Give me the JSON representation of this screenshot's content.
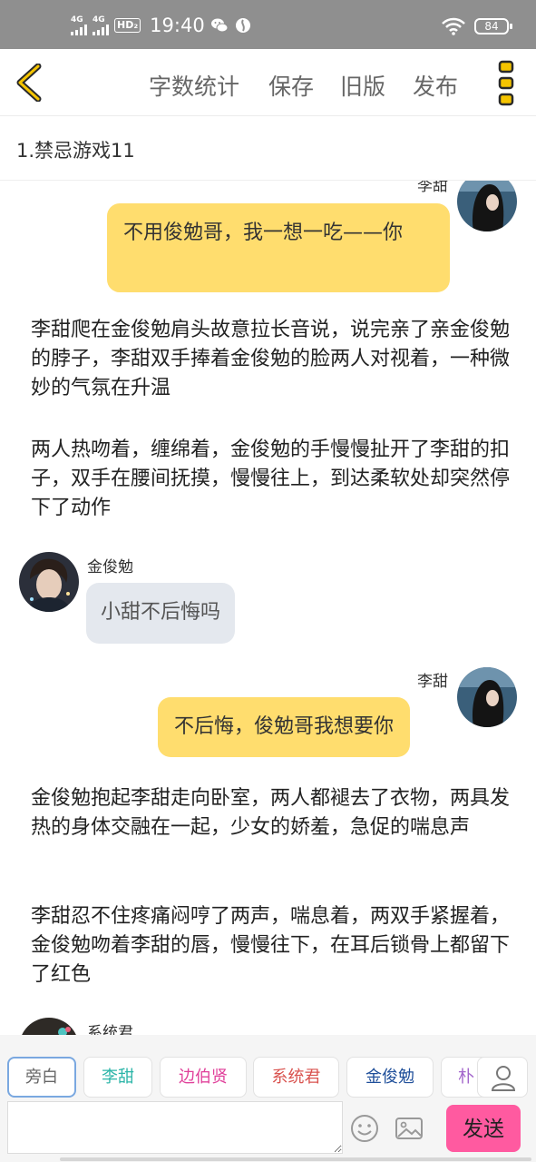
{
  "status_bar": {
    "net1": "4G",
    "net2": "4G",
    "hd": "HD₂",
    "time": "19:40",
    "battery": "84"
  },
  "toolbar": {
    "word_count": "字数统计",
    "save": "保存",
    "old_version": "旧版",
    "publish": "发布"
  },
  "document": {
    "title": "1.禁忌游戏11"
  },
  "messages": [
    {
      "speaker": "李甜",
      "text": "不用俊勉哥，我一想一吃——你"
    },
    {
      "narration": "李甜爬在金俊勉肩头故意拉长音说，说完亲了亲金俊勉的脖子，李甜双手捧着金俊勉的脸两人对视着，一种微妙的气氛在升温"
    },
    {
      "narration": "两人热吻着，缠绵着，金俊勉的手慢慢扯开了李甜的扣子，双手在腰间抚摸，慢慢往上，到达柔软处却突然停下了动作"
    },
    {
      "speaker": "金俊勉",
      "text": "小甜不后悔吗"
    },
    {
      "speaker": "李甜",
      "text": "不后悔，俊勉哥我想要你"
    },
    {
      "narration": "金俊勉抱起李甜走向卧室，两人都褪去了衣物，两具发热的身体交融在一起，少女的娇羞，急促的喘息声"
    },
    {
      "narration": "李甜忍不住疼痛闷哼了两声，喘息着，两双手紧握着，金俊勉吻着李甜的唇，慢慢往下，在耳后锁骨上都留下了红色"
    },
    {
      "speaker": "系统君"
    }
  ],
  "characters": [
    {
      "label": "旁白",
      "color": "#666666"
    },
    {
      "label": "李甜",
      "color": "#2bb5a8"
    },
    {
      "label": "边伯贤",
      "color": "#e0409a"
    },
    {
      "label": "系统君",
      "color": "#d9534f"
    },
    {
      "label": "金俊勉",
      "color": "#1f4f9a"
    },
    {
      "label": "朴",
      "color": "#a366cc"
    }
  ],
  "composer": {
    "placeholder": "",
    "send": "发送"
  }
}
